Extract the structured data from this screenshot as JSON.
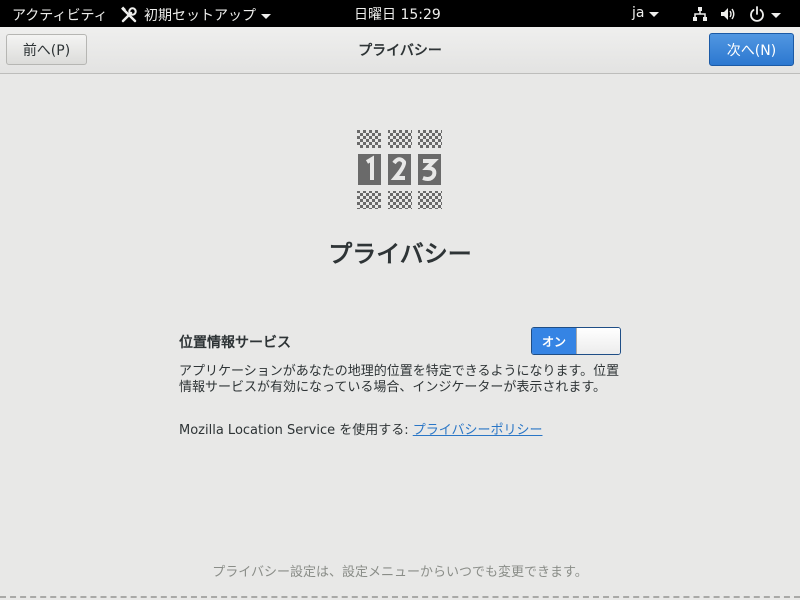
{
  "topbar": {
    "activities": "アクティビティ",
    "app_menu": "初期セットアップ",
    "clock": "日曜日 15:29",
    "language": "ja",
    "icons": [
      "network-wired-icon",
      "volume-icon",
      "power-icon"
    ]
  },
  "header": {
    "back_label": "前へ(P)",
    "title": "プライバシー",
    "next_label": "次へ(N)"
  },
  "main": {
    "heading": "プライバシー",
    "icon": "privacy-123-icon",
    "location": {
      "label": "位置情報サービス",
      "toggle_state": "オン",
      "enabled": true,
      "description": "アプリケーションがあなたの地理的位置を特定できるようになります。位置情報サービスが有効になっている場合、インジケーターが表示されます。",
      "mls_text": "Mozilla Location Service を使用する: ",
      "policy_link": "プライバシーポリシー"
    },
    "footer_note": "プライバシー設定は、設定メニューからいつでも変更できます。"
  },
  "colors": {
    "accent": "#3584e4",
    "topbar_bg": "#000000",
    "background": "#e8e8e7",
    "link": "#2a76c6"
  }
}
